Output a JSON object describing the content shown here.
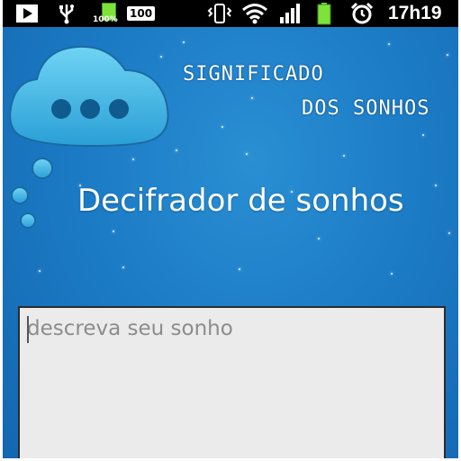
{
  "status_bar": {
    "battery_small_label": "100%",
    "battery_badge": "100",
    "time": "17h19",
    "icons": [
      "play-icon",
      "usb-icon",
      "battery-small-icon",
      "vibrate-icon",
      "wifi-icon",
      "signal-icon",
      "battery-icon",
      "alarm-icon"
    ]
  },
  "app": {
    "title_line1": "Significado",
    "title_line2": "dos sonhos",
    "logo_icon": "thought-cloud-icon"
  },
  "main": {
    "heading": "Decifrador de sonhos",
    "dream_input": {
      "placeholder": "descreva seu sonho",
      "value": ""
    }
  },
  "colors": {
    "background": "#1c7cc6",
    "cloud": "#3fb6e3",
    "input_bg": "#ebebeb",
    "battery_green": "#7be33a"
  }
}
